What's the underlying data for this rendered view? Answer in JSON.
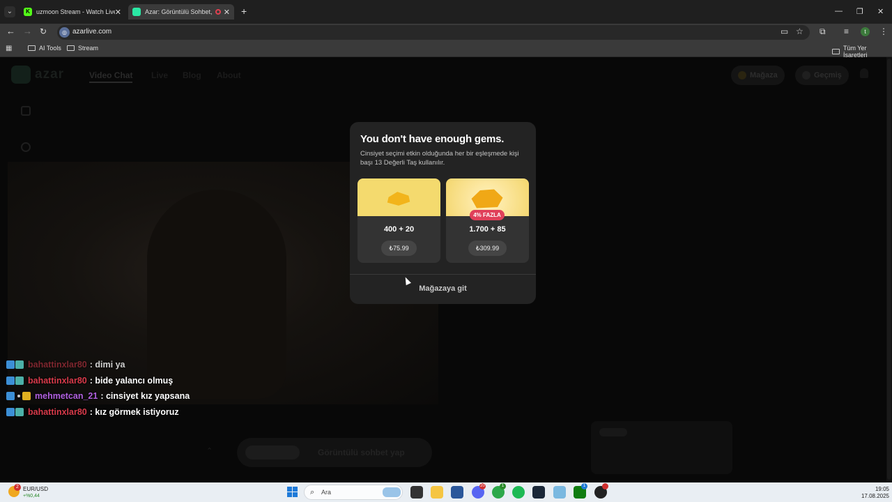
{
  "browser": {
    "tabs": [
      {
        "title": "uzmoon Stream - Watch Live o",
        "favicon": "K"
      },
      {
        "title": "Azar: Görüntülü Sohbet, Ar",
        "favicon": "azar",
        "recording": true
      }
    ],
    "new_tab_icon": "+",
    "url": "azarlive.com",
    "bookmarks": [
      "AI Tools",
      "Stream"
    ],
    "all_bookmarks": "Tüm Yer İşaretleri",
    "profile_initial": "t"
  },
  "site": {
    "logo_text": "azar",
    "nav": [
      "Video Chat",
      "Live",
      "Blog",
      "About"
    ],
    "store_label": "Mağaza",
    "history_label": "Geçmiş",
    "start_button_label": "Görüntülü sohbet yap"
  },
  "modal": {
    "title": "You don't have enough gems.",
    "description": "Cinsiyet seçimi etkin olduğunda her bir eşleşmede kişi başı 13 Değerli Taş kullanılır.",
    "packages": [
      {
        "amount": "400 + 20",
        "price": "₺75.99",
        "bonus": ""
      },
      {
        "amount": "1.700 + 85",
        "price": "₺309.99",
        "bonus": "4% FAZLA"
      }
    ],
    "store_link": "Mağazaya git"
  },
  "chat": [
    {
      "user": "bahattinxlar80",
      "message": ": dimi ya",
      "user_color": "#d83a4a",
      "badges": [
        "play",
        "square"
      ]
    },
    {
      "user": "bahattinxlar80",
      "message": ": bide yalancı olmuş",
      "user_color": "#d83a4a",
      "badges": [
        "play",
        "square"
      ]
    },
    {
      "user": "mehmetcan_21",
      "message": ": cinsiyet kız yapsana",
      "user_color": "#b060e0",
      "badges": [
        "play",
        "dot",
        "crown"
      ]
    },
    {
      "user": "bahattinxlar80",
      "message": ": kız görmek istiyoruz",
      "user_color": "#d83a4a",
      "badges": [
        "play",
        "square"
      ]
    }
  ],
  "taskbar": {
    "weather_badge": "2",
    "ticker_name": "EUR/USD",
    "ticker_change": "+%0,44",
    "search_placeholder": "Ara",
    "time": "19:05",
    "date": "17.08.2025",
    "app_badges": [
      "20",
      "1",
      "1"
    ]
  }
}
